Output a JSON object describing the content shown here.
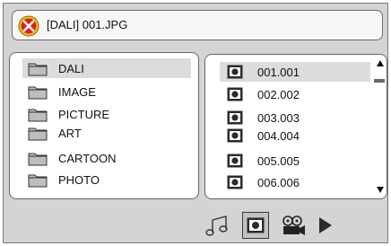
{
  "title_bar": {
    "text": "[DALI] 001.JPG",
    "icon": "no-symbol-icon"
  },
  "folders": {
    "items": [
      {
        "label": "DALI",
        "selected": true
      },
      {
        "label": "IMAGE"
      },
      {
        "label": "PICTURE"
      },
      {
        "label": "ART"
      },
      {
        "label": "CARTOON"
      },
      {
        "label": "PHOTO"
      }
    ]
  },
  "files": {
    "items": [
      {
        "label": "001.001",
        "selected": true
      },
      {
        "label": "002.002"
      },
      {
        "label": "003.003"
      },
      {
        "label": "004.004"
      },
      {
        "label": "005.005"
      },
      {
        "label": "006.006"
      }
    ]
  },
  "mode_bar": {
    "items": [
      {
        "icon": "music-note-icon"
      },
      {
        "icon": "photo-icon",
        "active": true
      },
      {
        "icon": "movie-projector-icon"
      },
      {
        "icon": "play-icon"
      }
    ]
  },
  "colors": {
    "frame_bg": "#d4d4d4",
    "selected_row": "#dcdcdc",
    "no_symbol_red": "#e0201a",
    "no_symbol_yellow": "#f3c51a"
  }
}
